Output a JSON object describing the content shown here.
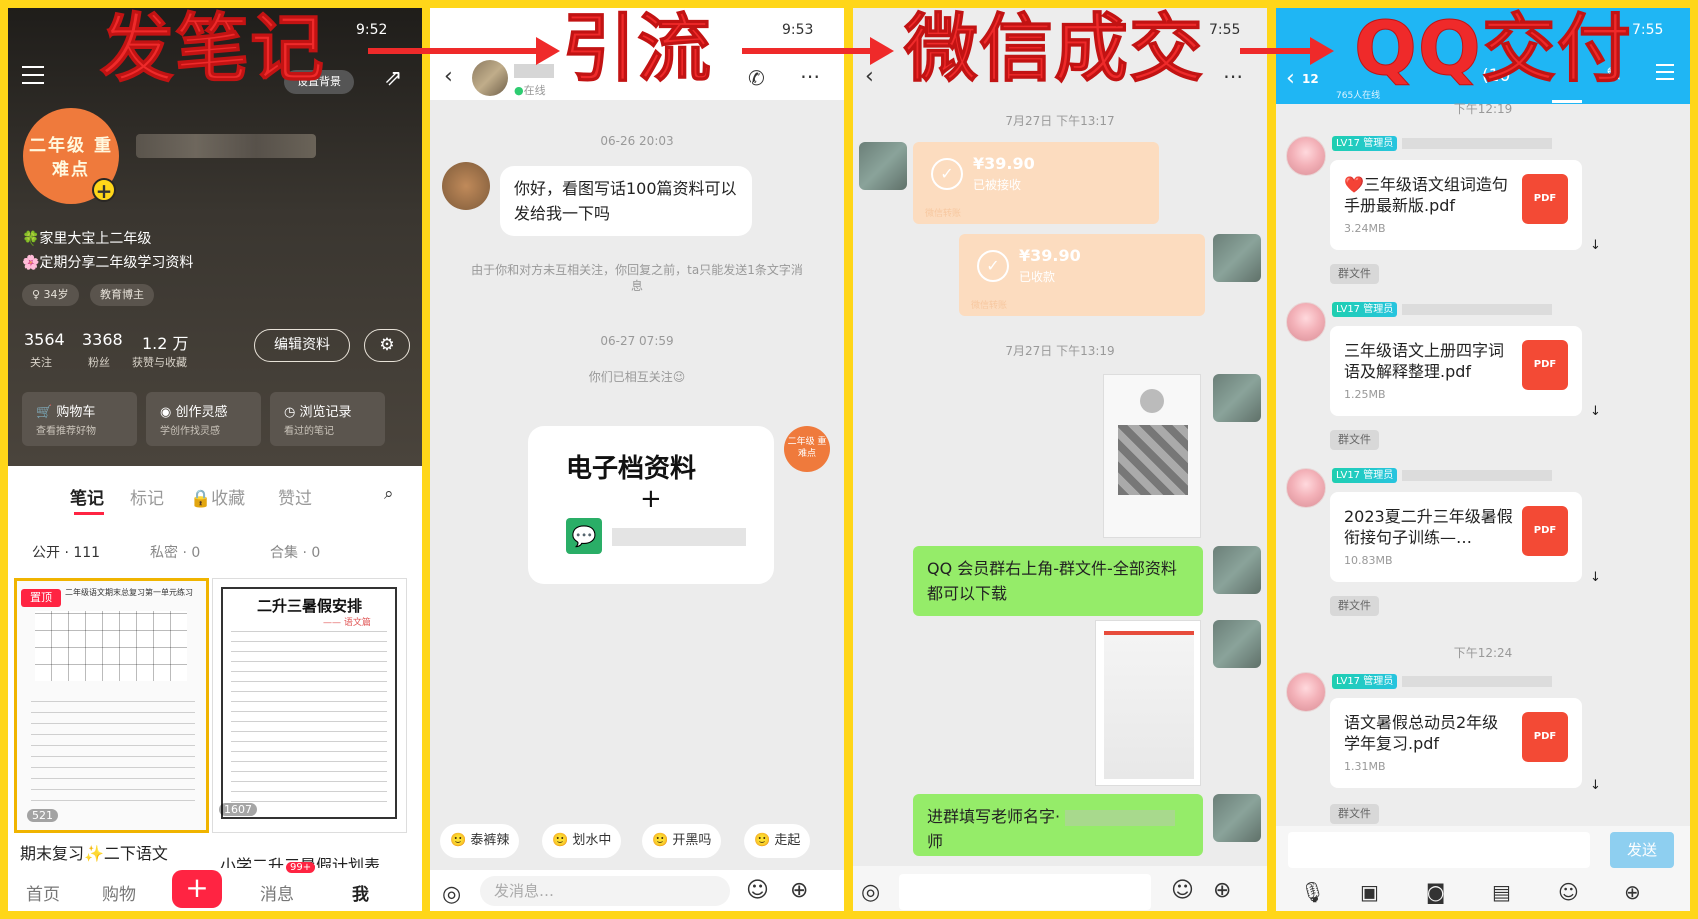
{
  "overlay": {
    "step1": "发笔记",
    "step2": "引流",
    "step3": "微信成交",
    "step4": "QQ交付"
  },
  "panel1": {
    "time": "9:52",
    "avatar_text": "二年级 重难点",
    "bio_line1": "🍀家里大宝上二年级",
    "bio_line2": "🌸定期分享二年级学习资料",
    "chip_age": "♀ 34岁",
    "chip_edu": "教育博主",
    "stats": [
      {
        "num": "3564",
        "label": "关注"
      },
      {
        "num": "3368",
        "label": "粉丝"
      },
      {
        "num": "1.2 万",
        "label": "获赞与收藏"
      }
    ],
    "edit_label": "编辑资料",
    "settings_label": "设置背景",
    "cards": [
      {
        "title": "购物车",
        "sub": "查看推荐好物"
      },
      {
        "title": "创作灵感",
        "sub": "学创作找灵感"
      },
      {
        "title": "浏览记录",
        "sub": "看过的笔记"
      }
    ],
    "tabs": [
      "笔记",
      "标记",
      "收藏",
      "赞过"
    ],
    "subtabs": [
      "公开 · 111",
      "私密 · 0",
      "合集 · 0"
    ],
    "note1": {
      "pin": "置顶",
      "views": "521",
      "title": "期末复习✨二下语文",
      "sub_title": "二年级语文期末总复习第一单元练习"
    },
    "note2": {
      "heading": "二升三暑假安排",
      "subheading": "—— 语文篇",
      "views": "1607",
      "title": "小学二升三暑假计划表"
    },
    "nav": [
      "首页",
      "购物",
      "+",
      "消息",
      "我"
    ],
    "nav_badge": "99+"
  },
  "panel2": {
    "time": "9:53",
    "status": "在线",
    "t1": "06-26 20:03",
    "msg1": "你好，看图写话100篇资料可以发给我一下吗",
    "sys1": "由于你和对方未互相关注，你回复之前，ta只能发送1条文字消息",
    "t2": "06-27 07:59",
    "sys2": "你们已相互关注😉",
    "card_title": "电子档资料",
    "card_plus": "+",
    "ava_small": "二年级 重难点",
    "quick": [
      "泰裤辣",
      "划水中",
      "开黑吗",
      "走起"
    ],
    "input_placeholder": "发消息…"
  },
  "panel3": {
    "time": "7:55",
    "t1": "7月27日 下午13:17",
    "tr1": {
      "amount": "¥39.90",
      "status": "已被接收",
      "foot": "微信转账"
    },
    "tr2": {
      "amount": "¥39.90",
      "status": "已收款",
      "foot": "微信转账"
    },
    "t2": "7月27日 下午13:19",
    "msg1": "QQ 会员群右上角-群文件-全部资料都可以下载",
    "msg2": "进群填写老师名字·",
    "msg2_end": "师"
  },
  "panel4": {
    "time": "7:55",
    "back_count": "12",
    "online": "765人在线",
    "title_tail": "(10",
    "t_top": "下午12:19",
    "badge": "LV17 管理员",
    "files": [
      {
        "name": "❤️三年级语文组词造句手册最新版.pdf",
        "size": "3.24MB"
      },
      {
        "name": "三年级语文上册四字词语及解释整理.pdf",
        "size": "1.25MB"
      },
      {
        "name": "2023夏二升三年级暑假衔接句子训练—…",
        "size": "10.83MB"
      },
      {
        "name": "语文暑假总动员2年级学年复习.pdf",
        "size": "1.31MB"
      }
    ],
    "tag": "群文件",
    "pdf_label": "PDF",
    "t_mid": "下午12:24",
    "send": "发送"
  }
}
